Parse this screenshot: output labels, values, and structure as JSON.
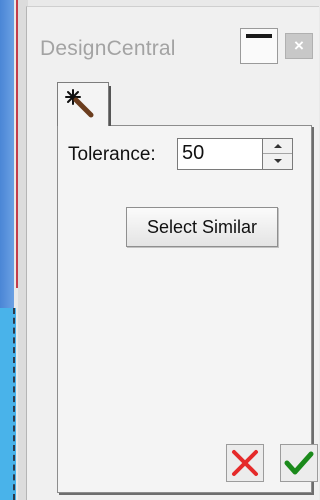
{
  "window": {
    "title": "DesignCentral",
    "close_glyph": "×"
  },
  "tabs": [
    {
      "icon": "magic-wand-icon",
      "active": true
    }
  ],
  "tolerance": {
    "label": "Tolerance:",
    "value": "50"
  },
  "actions": {
    "select_similar_label": "Select Similar",
    "cancel_icon": "red-x-icon",
    "ok_icon": "green-check-icon"
  },
  "colors": {
    "cancel": "#e52a2a",
    "ok": "#1b8a1b"
  }
}
